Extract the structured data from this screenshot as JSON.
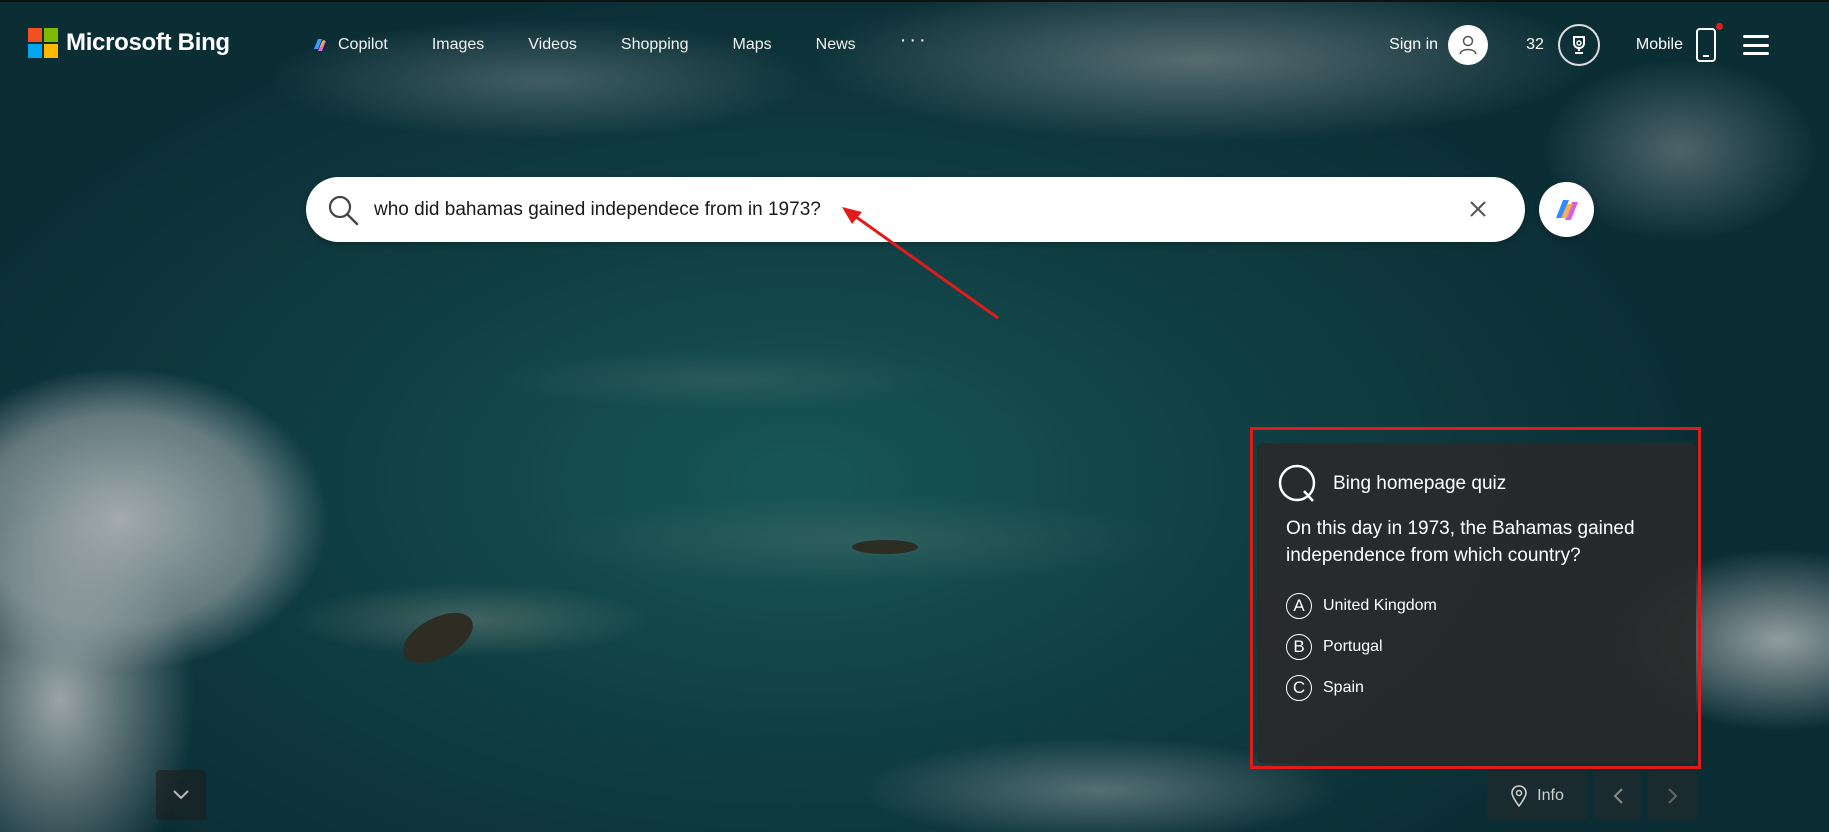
{
  "brand": {
    "name": "Microsoft Bing",
    "colors": [
      "#f25022",
      "#7fba00",
      "#00a4ef",
      "#ffb900"
    ]
  },
  "nav": {
    "items": [
      {
        "label": "Copilot",
        "icon": "copilot-icon"
      },
      {
        "label": "Images"
      },
      {
        "label": "Videos"
      },
      {
        "label": "Shopping"
      },
      {
        "label": "Maps"
      },
      {
        "label": "News"
      }
    ],
    "more_label": "···"
  },
  "header": {
    "signin_label": "Sign in",
    "points": "32",
    "mobile_label": "Mobile"
  },
  "search": {
    "query": "who did bahamas gained independece from in 1973?"
  },
  "quiz": {
    "title": "Bing homepage quiz",
    "question": "On this day in 1973, the Bahamas gained independence from which country?",
    "options": [
      {
        "letter": "A",
        "label": "United Kingdom"
      },
      {
        "letter": "B",
        "label": "Portugal"
      },
      {
        "letter": "C",
        "label": "Spain"
      }
    ]
  },
  "footer": {
    "info_label": "Info"
  },
  "colors": {
    "annotation": "#e11a1a",
    "background": "#1a5c60"
  }
}
